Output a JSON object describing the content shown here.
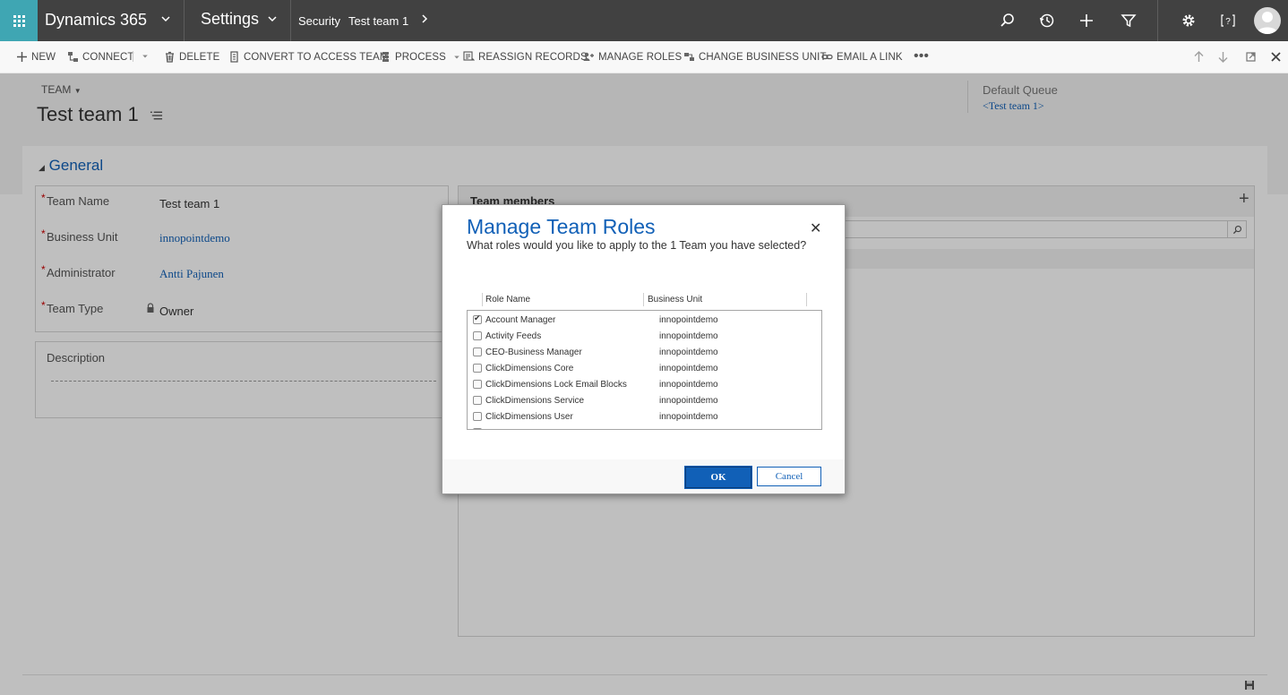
{
  "topbar": {
    "app_name": "Dynamics 365",
    "area": "Settings",
    "breadcrumb": [
      "Security",
      "Test team 1"
    ]
  },
  "commands": [
    {
      "label": "NEW",
      "icon": "plus-icon"
    },
    {
      "label": "CONNECT",
      "icon": "connect-icon"
    },
    {
      "label": "DELETE",
      "icon": "trash-icon"
    },
    {
      "label": "CONVERT TO ACCESS TEAM",
      "icon": "convert-icon"
    },
    {
      "label": "PROCESS",
      "icon": "process-icon"
    },
    {
      "label": "REASSIGN RECORDS",
      "icon": "reassign-icon"
    },
    {
      "label": "MANAGE ROLES",
      "icon": "roles-icon"
    },
    {
      "label": "CHANGE BUSINESS UNIT",
      "icon": "business-unit-icon"
    },
    {
      "label": "EMAIL A LINK",
      "icon": "link-icon"
    }
  ],
  "header": {
    "entity": "TEAM",
    "title": "Test team 1",
    "default_queue_label": "Default Queue",
    "default_queue_value": "<Test team 1>"
  },
  "form": {
    "section_title": "General",
    "fields": {
      "team_name_label": "Team Name",
      "team_name_value": "Test team 1",
      "business_unit_label": "Business Unit",
      "business_unit_value": "innopointdemo",
      "administrator_label": "Administrator",
      "administrator_value": "Antti Pajunen",
      "team_type_label": "Team Type",
      "team_type_value": "Owner"
    },
    "description_label": "Description",
    "subgrid_title": "Team members"
  },
  "dialog": {
    "title": "Manage Team Roles",
    "subtitle": "What roles would you like to apply to the 1 Team you have selected?",
    "col_role": "Role Name",
    "col_bu": "Business Unit",
    "roles": [
      {
        "name": "Account Manager",
        "bu": "innopointdemo",
        "checked": true
      },
      {
        "name": "Activity Feeds",
        "bu": "innopointdemo",
        "checked": false
      },
      {
        "name": "CEO-Business Manager",
        "bu": "innopointdemo",
        "checked": false
      },
      {
        "name": "ClickDimensions Core",
        "bu": "innopointdemo",
        "checked": false
      },
      {
        "name": "ClickDimensions Lock Email Blocks",
        "bu": "innopointdemo",
        "checked": false
      },
      {
        "name": "ClickDimensions Service",
        "bu": "innopointdemo",
        "checked": false
      },
      {
        "name": "ClickDimensions User",
        "bu": "innopointdemo",
        "checked": false
      }
    ],
    "ok_label": "OK",
    "cancel_label": "Cancel"
  },
  "colors": {
    "accent": "#1160b7",
    "topbar": "#414141",
    "waffle": "#3fa6b3"
  }
}
